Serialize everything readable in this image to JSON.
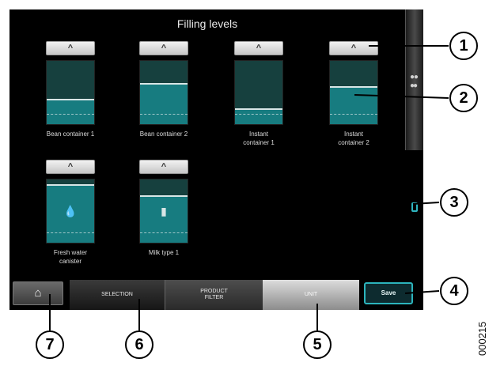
{
  "screen": {
    "title": "Filling levels"
  },
  "tiles": [
    {
      "label_line1": "Bean container 1",
      "label_line2": "",
      "fill_fraction": 0.38,
      "glyph": "",
      "up_symbol": "^"
    },
    {
      "label_line1": "Bean container 2",
      "label_line2": "",
      "fill_fraction": 0.62,
      "glyph": "",
      "up_symbol": "^"
    },
    {
      "label_line1": "Instant",
      "label_line2": "container 1",
      "fill_fraction": 0.22,
      "glyph": "",
      "up_symbol": "^"
    },
    {
      "label_line1": "Instant",
      "label_line2": "container 2",
      "fill_fraction": 0.58,
      "glyph": "",
      "up_symbol": "^"
    },
    {
      "label_line1": "Fresh water",
      "label_line2": "canister",
      "fill_fraction": 0.9,
      "glyph": "💧",
      "up_symbol": "^"
    },
    {
      "label_line1": "Milk type 1",
      "label_line2": "",
      "fill_fraction": 0.72,
      "glyph": "▮",
      "up_symbol": "^"
    }
  ],
  "right_strip": {
    "drops_icon": "drops-icon",
    "bottle_icon": "bottle-icon"
  },
  "bottom_nav": {
    "home_glyph": "⌂",
    "selection_label": "SELECTION",
    "filter_line1": "PRODUCT",
    "filter_line2": "FILTER",
    "unit_label": "UNIT",
    "save_label": "Save"
  },
  "callouts": [
    "1",
    "2",
    "3",
    "4",
    "5",
    "6",
    "7"
  ],
  "document_number": "000215",
  "colors": {
    "accent": "#2cb4bc",
    "fill": "#177c80",
    "empty": "#16403e"
  }
}
